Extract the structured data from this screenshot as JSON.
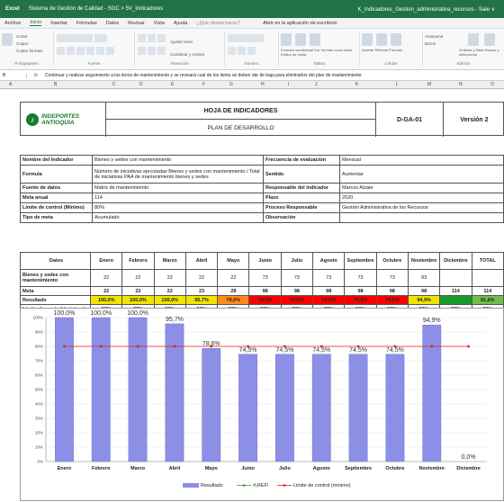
{
  "window": {
    "app": "Excel",
    "breadcrumb": "Sistema de Gestión de Calidad - SGC > 5V_Indicadores",
    "file": "K_Indicadores_Gestion_administrativa_recursos  -  Sale  ∨"
  },
  "menu": [
    "Archivo",
    "Inicio",
    "Insertar",
    "Fórmulas",
    "Datos",
    "Revisar",
    "Vista",
    "Ayuda",
    "¿Qué desea hacer?",
    "Abrir en la aplicación de escritorio"
  ],
  "ribbon": {
    "groups": [
      "Portapapeles",
      "Fuente",
      "Alineación",
      "Número",
      "Tablas",
      "Celdas",
      "Edición"
    ],
    "labels": [
      "Cortar",
      "Copiar",
      "Copiar formato",
      "Pegar",
      "Ajustar texto",
      "Combinar y centrar",
      "Formato condicional",
      "Dar formato como tabla",
      "Estilos de celda",
      "Insertar",
      "Eliminar",
      "Formato",
      "Autosuma",
      "Borrar",
      "Ordenar y filtrar",
      "Buscar y seleccionar"
    ]
  },
  "formula": {
    "ref": "B",
    "text": "Continuar y realizar seguimiento a los items de mantenimiento y se revisará cual de los items se deben dar de baja para eliminarlos del plan de mantenimiento"
  },
  "columns": [
    "A",
    "B",
    "C",
    "D",
    "E",
    "F",
    "G",
    "H",
    "I",
    "J",
    "K",
    "L",
    "M",
    "N",
    "O"
  ],
  "header": {
    "org_line1": "INDEPORTES",
    "org_line2": "ANTIOQUIA",
    "title": "HOJA DE INDICADORES",
    "subtitle": "PLAN DE DESARROLLO",
    "code": "D-GA-01",
    "version": "Versión 2"
  },
  "info": [
    {
      "k": "Nombre del Indicador",
      "v": "Bienes y sedes con mantenimiento",
      "k2": "Frecuencia de evaluación",
      "v2": "Mensual"
    },
    {
      "k": "Formula",
      "v": "Número de iniciativas ejecutadas Bienes y sedes con mantenimiento /  Total de iniciativas PAA de mantenimiento bienes y sedes",
      "k2": "Sentido",
      "v2": "Aumentar"
    },
    {
      "k": "Fuente de datos",
      "v": "Matriz de mantenimiento",
      "k2": "Responsable del indicador",
      "v2": "Marcos Alzate"
    },
    {
      "k": "Meta anual",
      "v": "114",
      "k2": "Plazo",
      "v2": "2020"
    },
    {
      "k": "Límite de control (Mínimo)",
      "v": "80%",
      "k2": "Proceso Responsable",
      "v2": "Gestión Administrativa de los Recursos"
    },
    {
      "k": "Tipo de meta",
      "v": "Acumulado",
      "k2": "Observación",
      "v2": ""
    }
  ],
  "months_header": [
    "Datos",
    "Enero",
    "Febrero",
    "Marzo",
    "Abril",
    "Mayo",
    "Junio",
    "Julio",
    "Agosto",
    "Septiembre",
    "Octubre",
    "Noviembre",
    "Diciembre",
    "TOTAL"
  ],
  "rows": [
    {
      "label": "Bienes y sedes con mantenimiento",
      "cells": [
        "22",
        "22",
        "22",
        "22",
        "22",
        "73",
        "73",
        "73",
        "73",
        "73",
        "93",
        "",
        ""
      ]
    },
    {
      "label": "Meta",
      "cells": [
        "22",
        "22",
        "22",
        "23",
        "28",
        "98",
        "98",
        "98",
        "98",
        "98",
        "98",
        "114",
        "114"
      ]
    },
    {
      "label": "Resultado",
      "cells": [
        "100,0%",
        "100,0%",
        "100,0%",
        "95,7%",
        "78,6%",
        "74,5%",
        "74,5%",
        "74,5%",
        "74,5%",
        "74,5%",
        "94,9%",
        "",
        "81,6%"
      ]
    },
    {
      "label": "Límite de control (mínimo)",
      "cells": [
        "80%",
        "80%",
        "80%",
        "80%",
        "80%",
        "80%",
        "80%",
        "80%",
        "80%",
        "80%",
        "80%",
        "80%",
        "80%"
      ]
    }
  ],
  "result_colors": [
    "#f0e400",
    "#f0e400",
    "#f0e400",
    "#f0e400",
    "#ff8c1a",
    "#ff0000",
    "#ff0000",
    "#ff0000",
    "#ff0000",
    "#ff0000",
    "#f0e400",
    "#1a9a2a",
    "#6fbf4a"
  ],
  "chart_data": {
    "type": "bar",
    "categories": [
      "Enero",
      "Febrero",
      "Marzo",
      "Abril",
      "Mayo",
      "Junio",
      "Julio",
      "Agosto",
      "Septiembre",
      "Octubre",
      "Noviembre",
      "Diciembre"
    ],
    "series": [
      {
        "name": "Resultado",
        "values": [
          100.0,
          100.0,
          100.0,
          95.7,
          78.6,
          74.5,
          74.5,
          74.5,
          74.5,
          74.5,
          94.9,
          0.0
        ]
      },
      {
        "name": "#¡REF!",
        "values": []
      },
      {
        "name": "Limite de control (mínimo)",
        "values": [
          80,
          80,
          80,
          80,
          80,
          80,
          80,
          80,
          80,
          80,
          80,
          80
        ]
      }
    ],
    "data_labels": [
      "100,0%",
      "100,0%",
      "100,0%",
      "95,7%",
      "78,6%",
      "74,5%",
      "74,5%",
      "74,5%",
      "74,5%",
      "74,5%",
      "94,9%",
      "0,0%"
    ],
    "yticks": [
      "0%",
      "10%",
      "20%",
      "30%",
      "40%",
      "50%",
      "60%",
      "70%",
      "80%",
      "90%",
      "100%"
    ],
    "ylim": [
      0,
      100
    ],
    "bar_color": "#8c8fe6",
    "limit_color": "#e02020",
    "legend_position": "bottom"
  }
}
